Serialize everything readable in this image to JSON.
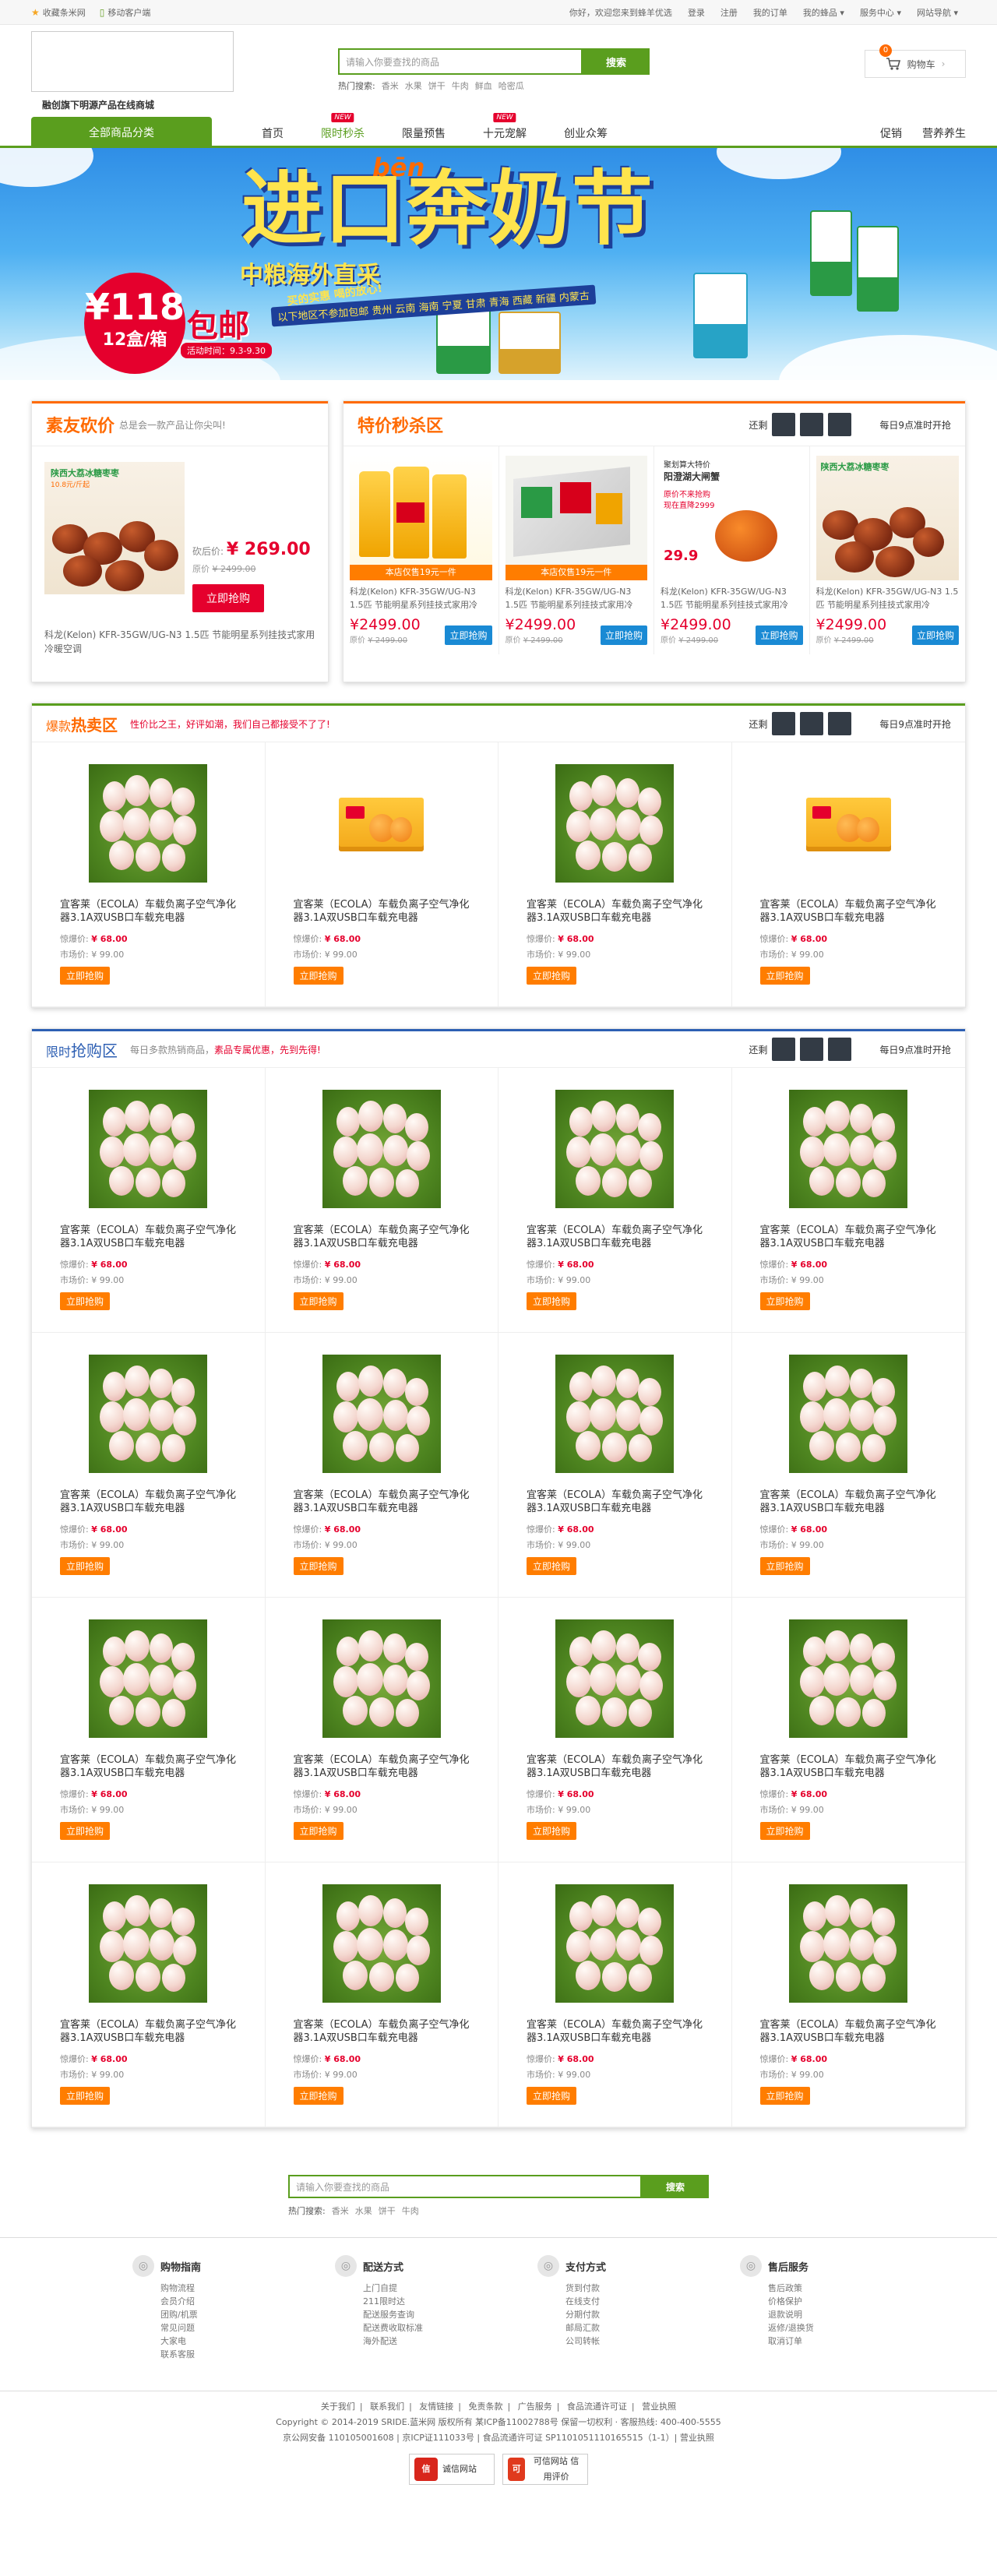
{
  "topbar": {
    "favorite": "收藏条米网",
    "mobile": "移动客户端",
    "welcome": "你好，欢迎您来到蜂羊优选",
    "login": "登录",
    "register": "注册",
    "orders": "我的订单",
    "my_goods": "我的蜂品",
    "service": "服务中心",
    "sitemap": "网站导航"
  },
  "header": {
    "slogan": "融创旗下明源产品在线商城",
    "search_placeholder": "请输入你要查找的商品",
    "search_button": "搜索",
    "hot_label": "热门搜索:",
    "hot_terms": [
      "香米",
      "水果",
      "饼干",
      "牛肉",
      "鲜血",
      "哈密瓜"
    ],
    "cart_label": "购物车",
    "cart_count": "0"
  },
  "nav": {
    "all_categories": "全部商品分类",
    "items": [
      {
        "label": "首页",
        "new": ""
      },
      {
        "label": "限时秒杀",
        "new": "NEW"
      },
      {
        "label": "限量预售",
        "new": ""
      },
      {
        "label": "十元宠解",
        "new": "NEW"
      },
      {
        "label": "创业众筹",
        "new": ""
      }
    ],
    "right": [
      "促销",
      "营养养生"
    ]
  },
  "banner": {
    "title": "进口奔奶节",
    "pinyin": "bēn",
    "subtitle": "中粮海外直采",
    "slogan": "买的实惠 喝的放心!",
    "areas": "以下地区不参加包邮 贵州 云南 海南 宁夏 甘肃 青海 西藏 新疆 内蒙古",
    "price": "¥118",
    "unit": "12盒/箱",
    "free_ship": "包邮",
    "period": "活动时间：9.3-9.30"
  },
  "friend_deal": {
    "title": "素友砍价",
    "subtitle": "总是会一款产品让你尖叫!",
    "price_label": "砍后价:",
    "price": "¥ 269.00",
    "old_label": "原价",
    "old_price": "¥ 2499.00",
    "button": "立即抢购",
    "name": "科龙(Kelon) KFR-35GW/UG-N3 1.5匹 节能明星系列挂技式家用冷暖空调",
    "pic_label": "陕西大荔冰糖枣枣",
    "pic_sub": "10.8元/斤起"
  },
  "flash_sale": {
    "title": "特价秒杀区",
    "remain": "还剩",
    "next": "每日9点准时开抢",
    "items": [
      {
        "tag": "本店仅售19元一件",
        "name": "科龙(Kelon) KFR-35GW/UG-N3 1.5匹 节能明星系列挂技式家用冷",
        "price": "¥2499.00",
        "old": "¥ 2499.00",
        "button": "立即抢购"
      },
      {
        "tag": "本店仅售19元一件",
        "name": "科龙(Kelon) KFR-35GW/UG-N3 1.5匹 节能明星系列挂技式家用冷",
        "price": "¥2499.00",
        "old": "¥ 2499.00",
        "button": "立即抢购"
      },
      {
        "tag": "",
        "name": "科龙(Kelon) KFR-35GW/UG-N3 1.5匹 节能明星系列挂技式家用冷",
        "price": "¥2499.00",
        "old": "¥ 2499.00",
        "button": "立即抢购"
      },
      {
        "tag": "",
        "name": "科龙(Kelon) KFR-35GW/UG-N3 1.5匹 节能明星系列挂技式家用冷",
        "price": "¥2499.00",
        "old": "¥ 2499.00",
        "button": "立即抢购"
      }
    ],
    "pic3_lines": [
      "聚划算大特价",
      "阳澄湖大闸蟹",
      "原价不来抢购",
      "现在直降2999",
      "29.9"
    ],
    "pic4_label": "陕西大荔冰糖枣枣",
    "old_label": "原价"
  },
  "hot_sale": {
    "title_a": "爆款",
    "title_b": "热卖区",
    "subtitle": "性价比之王，好评如潮，我们自己都接受不了了!",
    "remain": "还剩",
    "next": "每日9点准时开抢",
    "items": [
      {
        "pic": "eggs",
        "name": "宜客莱（ECOLA）车载负离子空气净化器3.1A双USB口车载充电器",
        "price": "¥ 68.00",
        "market": "¥ 99.00"
      },
      {
        "pic": "orange",
        "name": "宜客莱（ECOLA）车载负离子空气净化器3.1A双USB口车载充电器",
        "price": "¥ 68.00",
        "market": "¥ 99.00"
      },
      {
        "pic": "eggs",
        "name": "宜客莱（ECOLA）车载负离子空气净化器3.1A双USB口车载充电器",
        "price": "¥ 68.00",
        "market": "¥ 99.00"
      },
      {
        "pic": "orange",
        "name": "宜客莱（ECOLA）车载负离子空气净化器3.1A双USB口车载充电器",
        "price": "¥ 68.00",
        "market": "¥ 99.00"
      }
    ]
  },
  "limited": {
    "title_a": "限时",
    "title_b": "抢购区",
    "subtitle_a": "每日多款热销商品，",
    "subtitle_b": "素品专属优惠，先到先得!",
    "remain": "还剩",
    "next": "每日9点准时开抢",
    "item_count": 16,
    "item": {
      "name": "宜客莱（ECOLA）车载负离子空气净化器3.1A双USB口车载充电器",
      "price": "¥ 68.00",
      "market": "¥ 99.00"
    }
  },
  "labels": {
    "price": "惊爆价:",
    "market": "市场价:",
    "buy": "立即抢购"
  },
  "footer_search": {
    "placeholder": "请输入你要查找的商品",
    "button": "搜索",
    "hot_label": "热门搜索:",
    "hot_terms": [
      "香米",
      "水果",
      "饼干",
      "牛肉"
    ]
  },
  "services": [
    {
      "title": "购物指南",
      "icon": "cart-icon",
      "items": [
        "购物流程",
        "会员介绍",
        "团购/机票",
        "常见问题",
        "大家电",
        "联系客服"
      ]
    },
    {
      "title": "配送方式",
      "icon": "truck-icon",
      "items": [
        "上门自提",
        "211限时达",
        "配送服务查询",
        "配送费收取标准",
        "海外配送"
      ]
    },
    {
      "title": "支付方式",
      "icon": "wallet-icon",
      "items": [
        "货到付款",
        "在线支付",
        "分期付款",
        "邮局汇款",
        "公司转帐"
      ]
    },
    {
      "title": "售后服务",
      "icon": "service-icon",
      "items": [
        "售后政策",
        "价格保护",
        "退款说明",
        "返修/退换货",
        "取消订单"
      ]
    }
  ],
  "footer": {
    "links": [
      "关于我们",
      "联系我们",
      "友情链接",
      "免责条款",
      "广告服务",
      "食品流通许可证",
      "营业执照"
    ],
    "copyright": "Copyright © 2014-2019 SRIDE.蓝米网 版权所有 某ICP备11002788号 保留一切权利 · 客服热线: 400-400-5555",
    "license": "京公网安备 110105001608 | 京ICP证111033号 | 食品流通许可证 SP1101051110165515（1-1）| 营业执照",
    "certs": [
      {
        "icon": "信",
        "label": "诚信网站"
      },
      {
        "icon": "可",
        "label": "可信网站 信用评价"
      }
    ]
  }
}
